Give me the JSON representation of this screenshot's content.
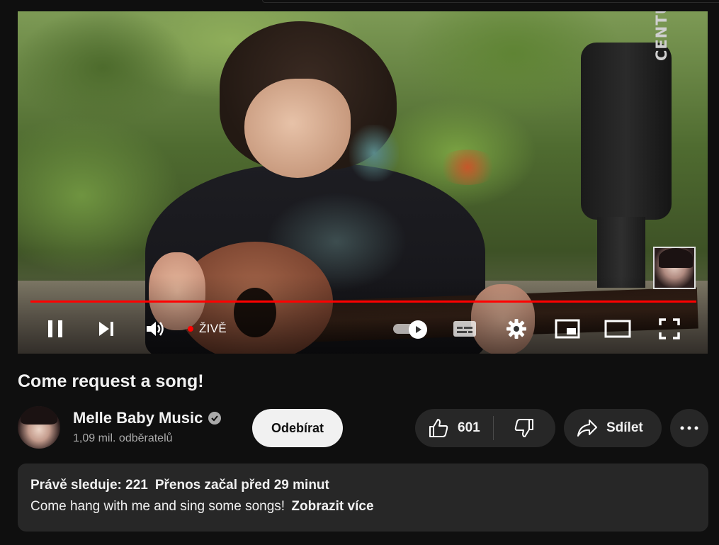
{
  "player": {
    "live_label": "ŽIVĚ",
    "progress_color": "#ff0000",
    "speaker_brand": "CENTURY"
  },
  "video": {
    "title": "Come request a song!"
  },
  "channel": {
    "name": "Melle Baby Music",
    "subscribers": "1,09 mil. odběratelů",
    "subscribe_label": "Odebírat"
  },
  "actions": {
    "likes": "601",
    "share_label": "Sdílet"
  },
  "description": {
    "watching": "Právě sleduje: 221",
    "started": "Přenos začal před 29 minut",
    "text": "Come hang with me and sing some songs!",
    "more_label": "Zobrazit více"
  },
  "colors": {
    "background": "#0f0f0f",
    "surface": "#272727",
    "accent_red": "#ff0000"
  },
  "icons": [
    "pause-icon",
    "next-icon",
    "volume-icon",
    "autoplay-icon",
    "subtitles-icon",
    "settings-icon",
    "miniplayer-icon",
    "theater-icon",
    "fullscreen-icon",
    "verified-icon",
    "like-icon",
    "dislike-icon",
    "share-icon",
    "more-icon"
  ]
}
